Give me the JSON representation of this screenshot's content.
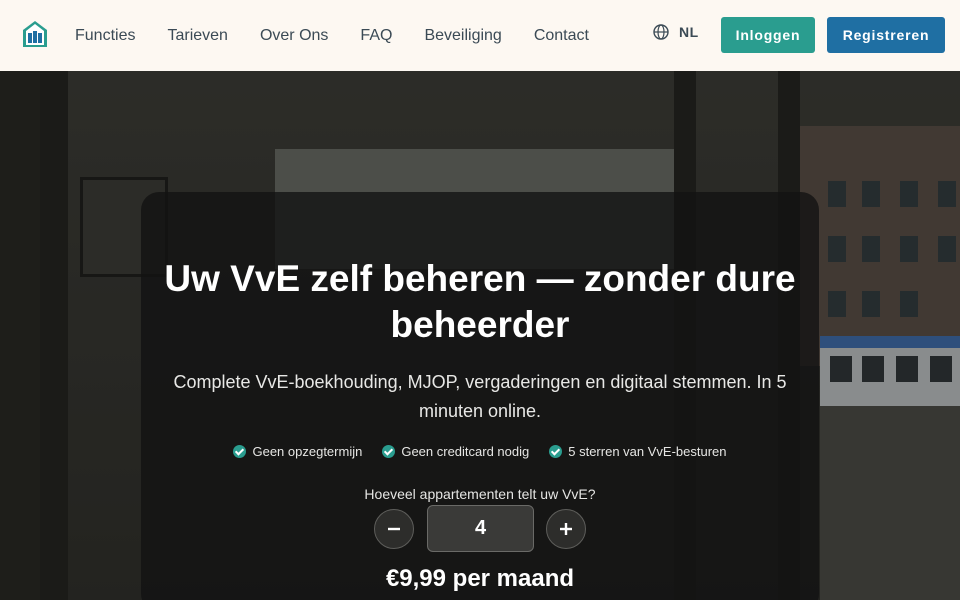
{
  "nav": {
    "links": [
      "Functies",
      "Tarieven",
      "Over Ons",
      "FAQ",
      "Beveiliging",
      "Contact"
    ],
    "language": "NL",
    "login_label": "Inloggen",
    "register_label": "Registreren"
  },
  "hero": {
    "title": "Uw VvE zelf beheren — zonder dure beheerder",
    "subtitle": "Complete VvE-boekhouding, MJOP, vergaderingen en digitaal stemmen. In 5 minuten online.",
    "checks": [
      "Geen opzegtermijn",
      "Geen creditcard nodig",
      "5 sterren van VvE-besturen"
    ],
    "question": "Hoeveel appartementen telt uw VvE?",
    "apartment_count": "4",
    "price": "€9,99 per maand"
  },
  "colors": {
    "accent_teal": "#2a9d8f",
    "accent_blue": "#1f6fa3",
    "nav_bg": "#fdf8f2"
  }
}
